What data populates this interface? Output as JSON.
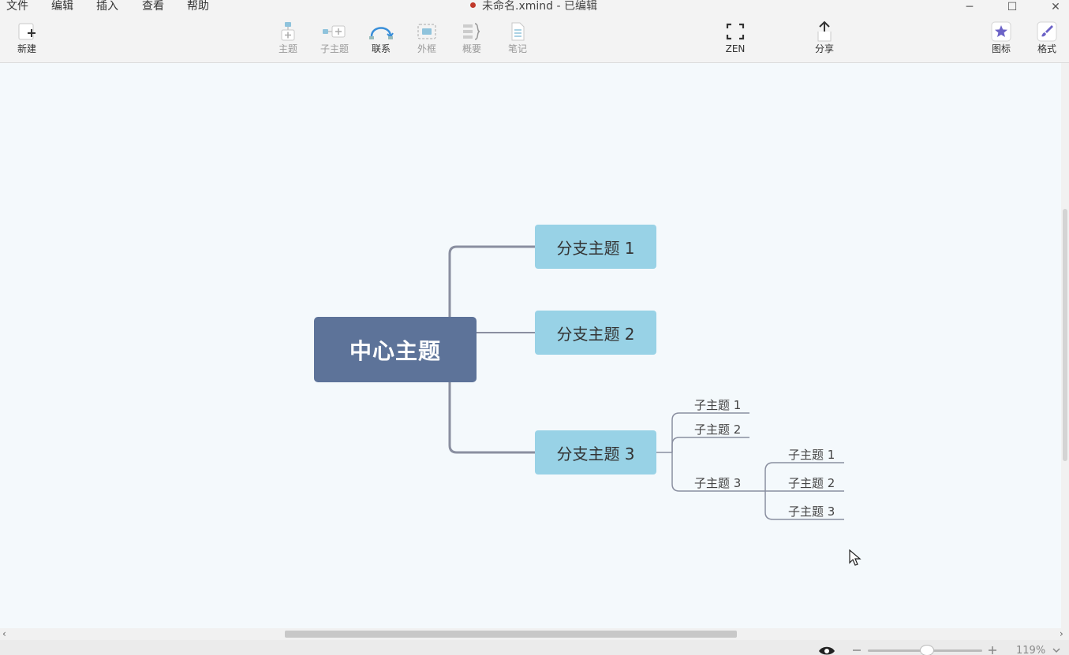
{
  "menu": [
    "文件",
    "编辑",
    "插入",
    "查看",
    "帮助"
  ],
  "window": {
    "title": "未命名.xmind - 已编辑",
    "modified_dot_color": "#c0392b",
    "minimize": "─",
    "maximize": "☐",
    "close": "✕"
  },
  "toolbar": {
    "new_label": "新建",
    "topic_label": "主题",
    "subtopic_label": "子主题",
    "relationship_label": "联系",
    "boundary_label": "外框",
    "summary_label": "概要",
    "notes_label": "笔记",
    "zen_label": "ZEN",
    "share_label": "分享",
    "icon_label": "图标",
    "format_label": "格式"
  },
  "mindmap": {
    "central": "中心主题",
    "branches": [
      {
        "label": "分支主题 1",
        "children": []
      },
      {
        "label": "分支主题 2",
        "children": []
      },
      {
        "label": "分支主题 3",
        "children": [
          {
            "label": "子主题 1",
            "children": []
          },
          {
            "label": "子主题 2",
            "children": []
          },
          {
            "label": "子主题 3",
            "children": [
              "子主题 1",
              "子主题 2",
              "子主题 3"
            ]
          }
        ]
      }
    ],
    "colors": {
      "central": "#5d7399",
      "branch": "#98d2e6",
      "connector": "#8a8fa0",
      "background": "#f4f9fc"
    }
  },
  "status": {
    "zoom": "119%",
    "zoom_level_fraction": 0.46
  }
}
